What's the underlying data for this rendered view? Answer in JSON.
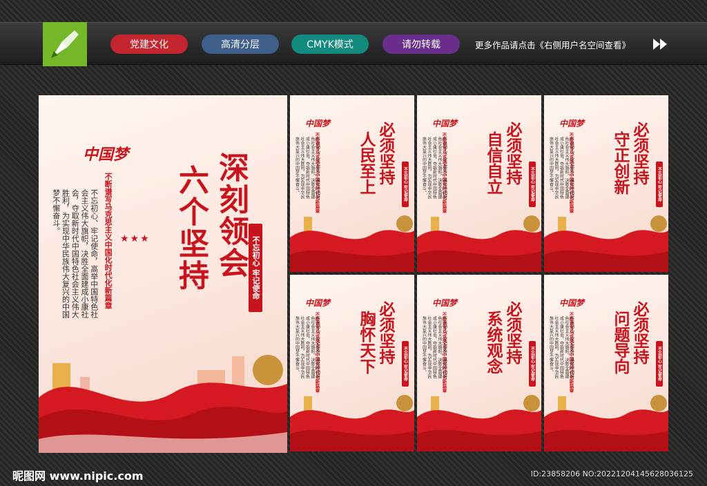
{
  "toolbar": {
    "tags": [
      "党建文化",
      "高清分层",
      "CMYK模式",
      "请勿转载"
    ],
    "more_text": "更多作品请点击《右侧用户名空间查看》",
    "colors": {
      "red": "#c3262e",
      "blue": "#3e5f8a",
      "teal": "#138a7e",
      "purple": "#6a2f8c",
      "logo_green": "#74b82a"
    }
  },
  "main_poster": {
    "title_line1": "深刻领会",
    "title_line2": "六个坚持",
    "subtitle": "不断谱写马克思主义中国化时代化新篇章",
    "body": "不忘初心、牢记使命，高举中国特色社会主义伟大旗帜，决胜全面建成小康社会，夺取新时代中国特色社会主义伟大胜利，为实现中华民族伟大复兴的中国梦不懈奋斗。",
    "seal": "不忘初心 牢记使命",
    "dream": "中国梦"
  },
  "small_posters": [
    {
      "must": "必须坚持",
      "theme": "人民至上"
    },
    {
      "must": "必须坚持",
      "theme": "自信自立"
    },
    {
      "must": "必须坚持",
      "theme": "守正创新"
    },
    {
      "must": "必须坚持",
      "theme": "胸怀天下"
    },
    {
      "must": "必须坚持",
      "theme": "系统观念"
    },
    {
      "must": "必须坚持",
      "theme": "问题导向"
    }
  ],
  "footer": {
    "site": "昵图网 www.nipic.com",
    "id": "ID:23858206 NO:20221204145628036125"
  }
}
